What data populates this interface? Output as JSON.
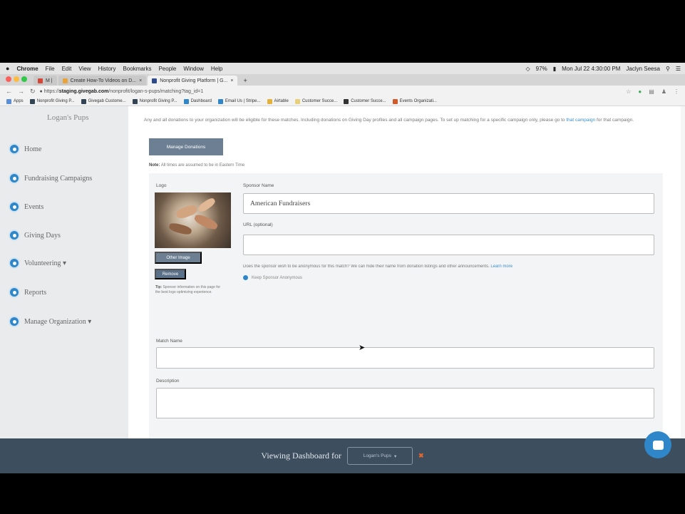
{
  "menubar": {
    "items": [
      "Chrome",
      "File",
      "Edit",
      "View",
      "History",
      "Bookmarks",
      "People",
      "Window",
      "Help"
    ],
    "battery": "97%",
    "datetime": "Mon Jul 22 4:30:00 PM",
    "user": "Jaclyn Seesa"
  },
  "tabs": [
    {
      "label": "M |",
      "active": false
    },
    {
      "label": "Create How-To Videos on D...",
      "active": false
    },
    {
      "label": "Nonprofit Giving Platform | G...",
      "active": true
    }
  ],
  "address": {
    "url_prefix": "https://",
    "url_host": "staging.givegab.com",
    "url_path": "/nonprofit/logan-s-pups/matching?tag_id=1"
  },
  "bookmarks": [
    "Apps",
    "Nonprofit Giving P...",
    "Givegab Custome...",
    "Nonprofit Giving P...",
    "Dashboard",
    "Email Us | Stripe...",
    "Airtable",
    "Customer Succe...",
    "Customer Succe...",
    "Events Organizati..."
  ],
  "sidebar": {
    "org_name": "Logan's Pups",
    "items": [
      {
        "label": "Home"
      },
      {
        "label": "Fundraising Campaigns"
      },
      {
        "label": "Events"
      },
      {
        "label": "Giving Days"
      },
      {
        "label": "Volunteering ▾"
      },
      {
        "label": "Reports"
      },
      {
        "label": "Manage Organization ▾"
      }
    ]
  },
  "main": {
    "notice_text": "Any and all donations to your organization will be eligible for these matches. Including donations on Giving Day profiles and all campaign pages. To set up matching for a specific campaign only, please go to",
    "notice_link": "that campaign",
    "notice_tail": "for that campaign.",
    "manage_donations_label": "Manage Donations",
    "note_bold": "Note:",
    "note_text": "All times are assumed to be in Eastern Time",
    "logo_label": "Logo",
    "other_image_label": "Other Image",
    "remove_label": "Remove",
    "tip_bold": "Tip:",
    "tip_text": "Sponsor information on this page for the best logo optimizing experience.",
    "sponsor_name_label": "Sponsor Name",
    "sponsor_name_value": "American Fundraisers",
    "url_label": "URL (optional)",
    "url_value": "",
    "anon_question": "Does the sponsor wish to be anonymous for this match? We can hide their name from donation listings and other announcements.",
    "anon_link": "Learn more",
    "anon_option": "Keep Sponsor Anonymous",
    "match_name_label": "Match Name",
    "match_name_value": "",
    "description_label": "Description",
    "description_value": ""
  },
  "footer": {
    "viewing_label": "Viewing Dashboard for",
    "selected_org": "Logan's Pups",
    "close_symbol": "✖"
  },
  "colors": {
    "brand_blue": "#2f86c9",
    "button_slate": "#6c7f93",
    "footer_bg": "#3d4e5f",
    "sidebar_bg": "#e9ebed"
  }
}
